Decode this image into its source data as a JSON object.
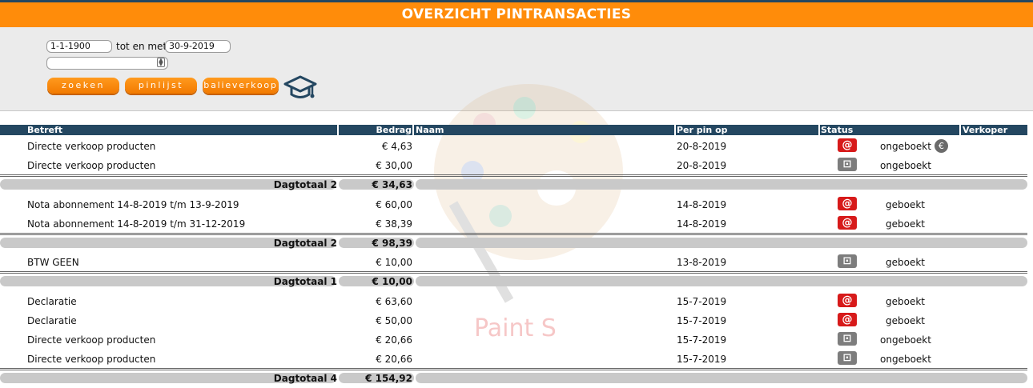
{
  "page": {
    "title": "OVERZICHT PINTRANSACTIES"
  },
  "filter": {
    "date_from": "1-1-1900",
    "tot_label": "tot en met",
    "date_to": "30-9-2019",
    "search_value": "",
    "buttons": {
      "zoeken": "zoeken",
      "pinlijst": "pinlijst",
      "balieverkoop": "balieverkoop"
    },
    "icon": "graduation-cap-icon"
  },
  "watermark": {
    "text": "Paint S"
  },
  "columns": {
    "betreft": "Betreft",
    "bedrag": "Bedrag",
    "naam": "Naam",
    "per_pin_op": "Per pin op",
    "status": "Status",
    "verkoper": "Verkoper"
  },
  "rows": [
    {
      "kind": "tx",
      "betreft": "Directe verkoop producten",
      "bedrag": "€ 4,63",
      "naam": "",
      "datum": "20-8-2019",
      "icon": "at-icon",
      "status": "ongeboekt",
      "euro": "€"
    },
    {
      "kind": "tx",
      "betreft": "Directe verkoop producten",
      "bedrag": "€ 30,00",
      "naam": "",
      "datum": "20-8-2019",
      "icon": "mailbox-icon",
      "status": "ongeboekt"
    },
    {
      "kind": "total",
      "label": "Dagtotaal 2",
      "bedrag": "€ 34,63"
    },
    {
      "kind": "tx",
      "betreft": "Nota abonnement 14-8-2019 t/m 13-9-2019",
      "bedrag": "€ 60,00",
      "naam": "",
      "datum": "14-8-2019",
      "icon": "at-icon",
      "status": "geboekt"
    },
    {
      "kind": "tx",
      "betreft": "Nota abonnement 14-8-2019 t/m 31-12-2019",
      "bedrag": "€ 38,39",
      "naam": "",
      "datum": "14-8-2019",
      "icon": "at-icon",
      "status": "geboekt"
    },
    {
      "kind": "total",
      "label": "Dagtotaal 2",
      "bedrag": "€ 98,39"
    },
    {
      "kind": "tx",
      "betreft": "BTW GEEN",
      "bedrag": "€ 10,00",
      "naam": "",
      "datum": "13-8-2019",
      "icon": "mailbox-icon",
      "status": "geboekt"
    },
    {
      "kind": "total",
      "label": "Dagtotaal 1",
      "bedrag": "€ 10,00"
    },
    {
      "kind": "tx",
      "betreft": "Declaratie",
      "bedrag": "€ 63,60",
      "naam": "",
      "datum": "15-7-2019",
      "icon": "at-icon",
      "status": "geboekt"
    },
    {
      "kind": "tx",
      "betreft": "Declaratie",
      "bedrag": "€ 50,00",
      "naam": "",
      "datum": "15-7-2019",
      "icon": "at-icon",
      "status": "geboekt"
    },
    {
      "kind": "tx",
      "betreft": "Directe verkoop producten",
      "bedrag": "€ 20,66",
      "naam": "",
      "datum": "15-7-2019",
      "icon": "mailbox-icon",
      "status": "ongeboekt"
    },
    {
      "kind": "tx",
      "betreft": "Directe verkoop producten",
      "bedrag": "€ 20,66",
      "naam": "",
      "datum": "15-7-2019",
      "icon": "mailbox-icon",
      "status": "ongeboekt"
    },
    {
      "kind": "total",
      "label": "Dagtotaal 4",
      "bedrag": "€ 154,92"
    }
  ],
  "colors": {
    "orange": "#ff8c0a",
    "navy": "#244761",
    "red_badge": "#d71a1a",
    "gray_badge": "#7d7d7d"
  }
}
